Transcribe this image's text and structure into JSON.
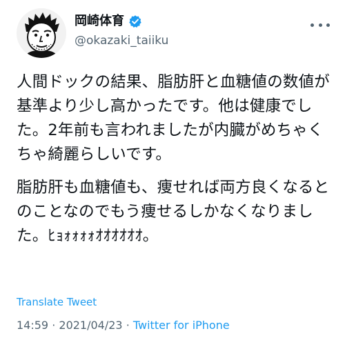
{
  "author": {
    "display_name": "岡崎体育",
    "handle": "@okazaki_taiiku",
    "verified": true,
    "avatar_icon": "cartoon-portrait-avatar"
  },
  "tweet": {
    "paragraph_1": "人間ドックの結果、脂肪肝と血糖値の数値が基準より少し高かったです。他は健康でした。2年前も言われましたが内臓がめちゃくちゃ綺麗らしいです。",
    "paragraph_2": "脂肪肝も血糖値も、痩せれば両方良くなるとのことなのでもう痩せるしかなくなりました。ﾋｮｫｫｫｫｵｵｵｵｵｵ。",
    "translate_label": "Translate Tweet",
    "time": "14:59",
    "date": "2021/04/23",
    "separator": "·",
    "source": "Twitter for iPhone"
  },
  "colors": {
    "accent": "#1d9bf0",
    "secondary_text": "#536471",
    "primary_text": "#0f1419"
  },
  "icons": {
    "verified": "verified-badge-icon",
    "more": "more-options-icon"
  }
}
